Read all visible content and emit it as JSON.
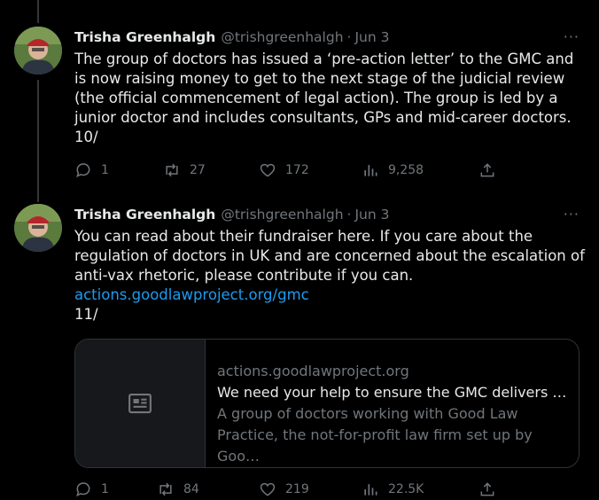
{
  "tweets": [
    {
      "author_name": "Trisha Greenhalgh",
      "handle": "@trishgreenhalgh",
      "separator": "·",
      "date": "Jun 3",
      "more": "···",
      "text": "The group of doctors has issued a ‘pre-action letter’ to the GMC and is now raising money to get to the next stage of the judicial review (the official commencement of legal action). The group is led by a junior doctor and includes consultants, GPs and mid-career doctors.",
      "thread_index": "10/",
      "replies": "1",
      "retweets": "27",
      "likes": "172",
      "views": "9,258"
    },
    {
      "author_name": "Trisha Greenhalgh",
      "handle": "@trishgreenhalgh",
      "separator": "·",
      "date": "Jun 3",
      "more": "···",
      "text": "You can read about their fundraiser here. If you care about the regulation of doctors in UK and are concerned about the escalation of anti-vax rhetoric, please contribute if you can.",
      "link": "actions.goodlawproject.org/gmc",
      "thread_index": "11/",
      "card": {
        "domain": "actions.goodlawproject.org",
        "title": "We need your help to ensure the GMC delivers on…",
        "description": "A group of doctors working with Good Law Practice, the not-for-profit law firm set up by Goo…"
      },
      "replies": "1",
      "retweets": "84",
      "likes": "219",
      "views": "22.5K"
    }
  ],
  "icons": [
    "reply-icon",
    "retweet-icon",
    "like-icon",
    "views-icon",
    "share-icon",
    "more-icon",
    "article-icon"
  ]
}
